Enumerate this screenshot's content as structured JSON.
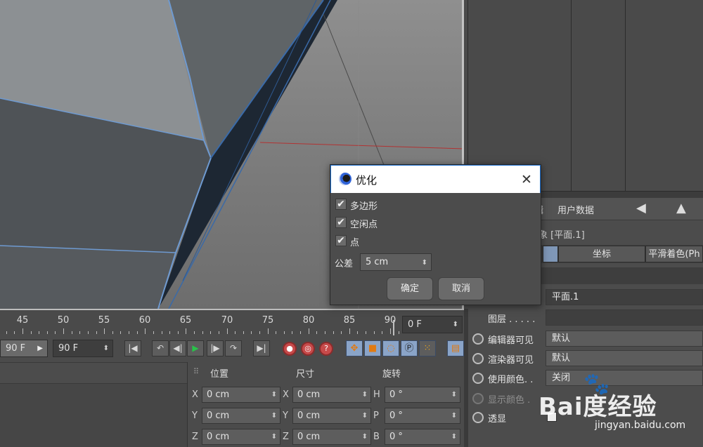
{
  "dialog": {
    "title": "优化",
    "checkboxes": [
      {
        "label": "多边形",
        "checked": true
      },
      {
        "label": "空闲点",
        "checked": true
      },
      {
        "label": "点",
        "checked": true
      }
    ],
    "tolerance_label": "公差",
    "tolerance_value": "5 cm",
    "ok_label": "确定",
    "cancel_label": "取消"
  },
  "timeline": {
    "ticks": [
      "45",
      "50",
      "55",
      "60",
      "65",
      "70",
      "75",
      "80",
      "85",
      "90"
    ],
    "current_frame": "0 F"
  },
  "transport": {
    "start_field": "90 F",
    "end_field": "90 F"
  },
  "coordinates": {
    "headers": {
      "position": "位置",
      "size": "尺寸",
      "rotation": "旋转"
    },
    "rows": [
      {
        "axis_pos": "X",
        "pos": "0 cm",
        "axis_size": "X",
        "size": "0 cm",
        "axis_rot": "H",
        "rot": "0 °"
      },
      {
        "axis_pos": "Y",
        "pos": "0 cm",
        "axis_size": "Y",
        "size": "0 cm",
        "axis_rot": "P",
        "rot": "0 °"
      },
      {
        "axis_pos": "Z",
        "pos": "0 cm",
        "axis_size": "Z",
        "size": "0 cm",
        "axis_rot": "B",
        "rot": "0 °"
      }
    ]
  },
  "attributes": {
    "menu": [
      "辑",
      "用户数据"
    ],
    "title": "象 [平面.1]",
    "tabs": [
      "",
      "坐标",
      "平滑着色(Ph"
    ],
    "rows": [
      {
        "label": "",
        "value": "平面.1",
        "radio": false,
        "dim": false
      },
      {
        "label": "图层 . . . . .",
        "value": "",
        "radio": false,
        "dim": false
      },
      {
        "label": "编辑器可见",
        "value": "默认",
        "radio": true,
        "dim": false
      },
      {
        "label": "渲染器可见",
        "value": "默认",
        "radio": true,
        "dim": false
      },
      {
        "label": "使用颜色. .",
        "value": "关闭",
        "radio": true,
        "dim": false
      },
      {
        "label": "显示颜色 .",
        "value": "",
        "radio": true,
        "dim": true
      },
      {
        "label": "透显",
        "value": "",
        "radio": true,
        "dim": false
      }
    ]
  },
  "watermark": {
    "brand": "Bai度经验",
    "url": "jingyan.baidu.com"
  }
}
